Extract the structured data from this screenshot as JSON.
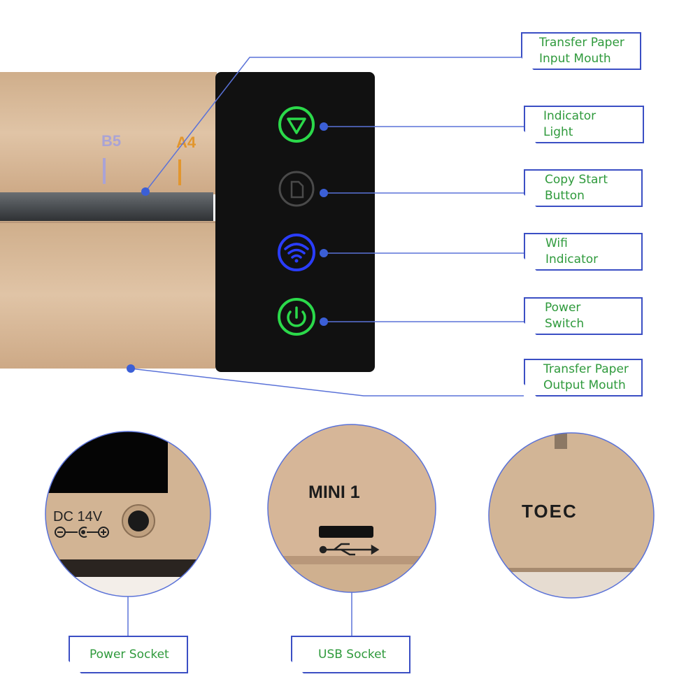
{
  "labels": {
    "input_mouth": [
      "Transfer Paper",
      "Input Mouth"
    ],
    "indicator_light": [
      "Indicator",
      "Light"
    ],
    "copy_start": [
      "Copy Start",
      "Button"
    ],
    "wifi": [
      "Wifi",
      "Indicator"
    ],
    "power_switch": [
      "Power",
      "Switch"
    ],
    "output_mouth": [
      "Transfer Paper",
      "Output Mouth"
    ],
    "power_socket": "Power Socket",
    "usb_socket": "USB Socket"
  },
  "printed_marks": {
    "b5": "B5",
    "a4": "A4",
    "dc": "DC 14V",
    "mini": "MINI 1",
    "brand": "TOEC"
  },
  "icons": [
    "indicator-triangle-icon",
    "copy-document-icon",
    "wifi-icon",
    "power-icon",
    "usb-icon"
  ],
  "colors": {
    "label_border": "#3b4fc4",
    "label_text": "#2f9a3c",
    "leader_line": "#5a72d8",
    "body_gold": "#d8b998",
    "panel_black": "#111111",
    "led_green": "#2bd94a",
    "led_blue": "#2a3dff"
  }
}
